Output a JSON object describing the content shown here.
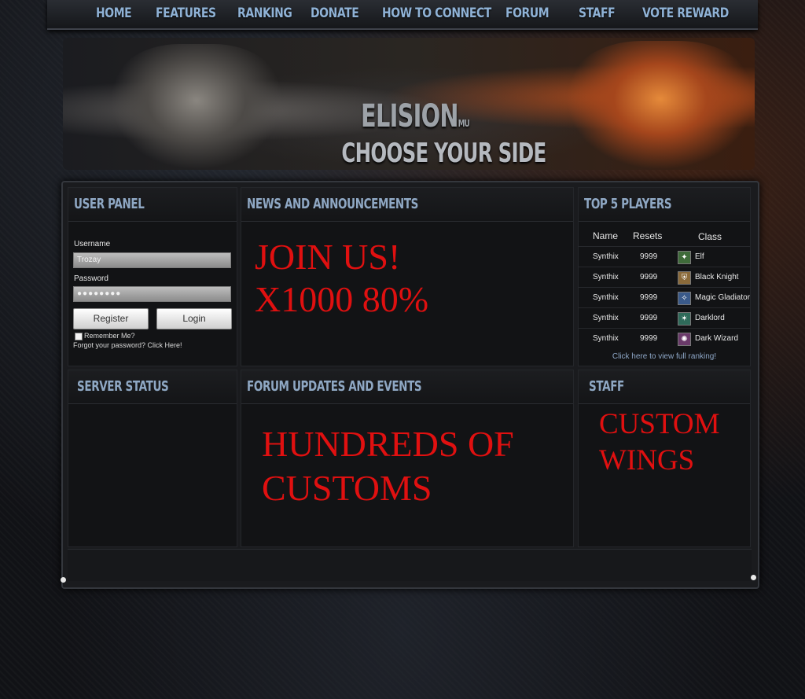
{
  "nav": {
    "items": [
      "HOME",
      "FEATURES",
      "RANKING",
      "DONATE",
      "HOW TO CONNECT",
      "FORUM",
      "STAFF",
      "VOTE REWARD"
    ]
  },
  "banner": {
    "logo_title": "ELISION",
    "logo_suffix": "MU",
    "tagline": "CHOOSE YOUR SIDE"
  },
  "user_panel": {
    "title": "USER PANEL",
    "username_label": "Username",
    "username_value": "Trozay",
    "password_label": "Password",
    "password_value": "●●●●●●●●",
    "register_label": "Register",
    "login_label": "Login",
    "remember_label": "Remember Me?",
    "forgot_label": "Forgot your password? Click Here!"
  },
  "news": {
    "title": "NEWS AND ANNOUNCEMENTS",
    "line1": "JOIN US!",
    "line2": "X1000  80%"
  },
  "top_players": {
    "title": "TOP 5 PLAYERS",
    "headers": [
      "Name",
      "Resets",
      "Class"
    ],
    "rows": [
      {
        "name": "Synthix",
        "resets": "9999",
        "class": "Elf",
        "icon": "elf-icon",
        "icon_color": "#3f6b3a"
      },
      {
        "name": "Synthix",
        "resets": "9999",
        "class": "Black Knight",
        "icon": "black-knight-icon",
        "icon_color": "#8a6a3a"
      },
      {
        "name": "Synthix",
        "resets": "9999",
        "class": "Magic Gladiator",
        "icon": "magic-gladiator-icon",
        "icon_color": "#3a5a8a"
      },
      {
        "name": "Synthix",
        "resets": "9999",
        "class": "Darklord",
        "icon": "darklord-icon",
        "icon_color": "#2f6b5a"
      },
      {
        "name": "Synthix",
        "resets": "9999",
        "class": "Dark Wizard",
        "icon": "dark-wizard-icon",
        "icon_color": "#6a3a6a"
      }
    ],
    "full_ranking_link": "Click here to view full ranking!"
  },
  "server_status": {
    "title": "SERVER STATUS"
  },
  "forum": {
    "title": "FORUM UPDATES AND EVENTS",
    "line1": "HUNDREDS OF",
    "line2": "CUSTOMS"
  },
  "staff": {
    "title": "STAFF",
    "line1": "CUSTOM",
    "line2": "WINGS"
  },
  "colors": {
    "accent_red": "#e01010",
    "nav_text": "#8fb2d6",
    "panel_title": "#8fa8c4"
  }
}
